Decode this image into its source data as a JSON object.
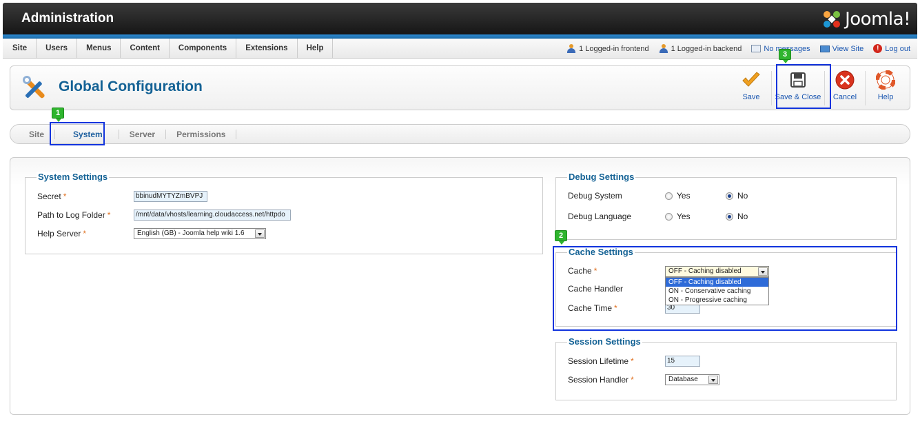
{
  "header": {
    "title": "Administration",
    "logo_text": "Joomla!"
  },
  "menu": [
    "Site",
    "Users",
    "Menus",
    "Content",
    "Components",
    "Extensions",
    "Help"
  ],
  "status": {
    "frontend": "1 Logged-in frontend",
    "backend": "1 Logged-in backend",
    "messages": "No messages",
    "view_site": "View Site",
    "logout": "Log out"
  },
  "page": {
    "title": "Global Configuration"
  },
  "toolbar": {
    "save": "Save",
    "save_close": "Save & Close",
    "cancel": "Cancel",
    "help": "Help"
  },
  "tabs": [
    "Site",
    "System",
    "Server",
    "Permissions"
  ],
  "system_settings": {
    "legend": "System Settings",
    "secret_label": "Secret",
    "secret_value": "bbinudMYTYZmBVPJ",
    "log_label": "Path to Log Folder",
    "log_value": "/mnt/data/vhosts/learning.cloudaccess.net/httpdo",
    "help_label": "Help Server",
    "help_value": "English (GB) - Joomla help wiki 1.6"
  },
  "debug_settings": {
    "legend": "Debug Settings",
    "system_label": "Debug System",
    "language_label": "Debug Language",
    "yes": "Yes",
    "no": "No"
  },
  "cache_settings": {
    "legend": "Cache Settings",
    "cache_label": "Cache",
    "cache_value": "OFF - Caching disabled",
    "handler_label": "Cache Handler",
    "time_label": "Cache Time",
    "time_value": "30",
    "options": [
      "OFF - Caching disabled",
      "ON - Conservative caching",
      "ON - Progressive caching"
    ]
  },
  "session_settings": {
    "legend": "Session Settings",
    "lifetime_label": "Session Lifetime",
    "lifetime_value": "15",
    "handler_label": "Session Handler",
    "handler_value": "Database"
  },
  "markers": [
    "1",
    "2",
    "3"
  ],
  "colors": {
    "accent_blue": "#146295",
    "highlight_box": "#1133dd",
    "marker_green": "#2fb52e"
  }
}
